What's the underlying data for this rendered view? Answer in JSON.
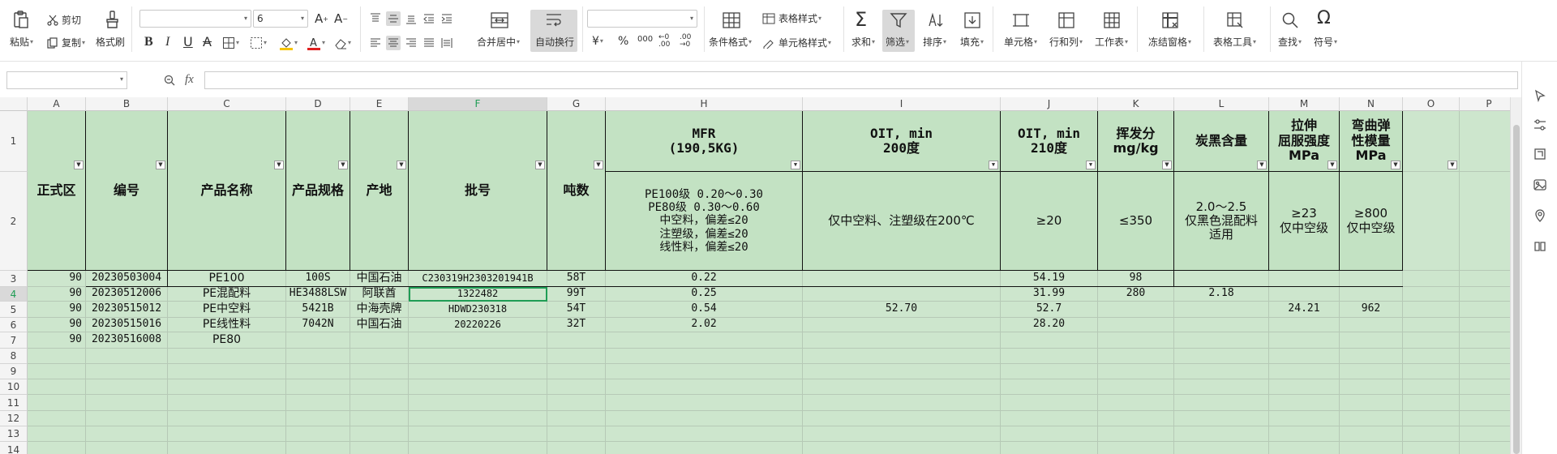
{
  "ribbon": {
    "paste": "粘贴",
    "cut": "剪切",
    "copy": "复制",
    "format_painter": "格式刷",
    "font_name": "",
    "font_size": "6",
    "merge_center": "合并居中",
    "wrap_text": "自动换行",
    "number_format": "",
    "currency": "¥",
    "percent": "%",
    "thousands": "000",
    "inc_decimal": "←0 .00",
    "dec_decimal": ".00 →0",
    "conditional_format": "条件格式",
    "table_style": "表格样式",
    "cell_style": "单元格样式",
    "sum": "求和",
    "filter": "筛选",
    "sort": "排序",
    "fill": "填充",
    "cell": "单元格",
    "row_col": "行和列",
    "worksheet": "工作表",
    "freeze": "冻结窗格",
    "table_tools": "表格工具",
    "find": "查找",
    "symbol": "符号",
    "bold": "B",
    "italic": "I",
    "underline": "U",
    "strike": "A"
  },
  "formula_bar": {
    "name_box": "",
    "fx": "fx",
    "formula": ""
  },
  "columns": [
    "A",
    "B",
    "C",
    "D",
    "E",
    "F",
    "G",
    "H",
    "I",
    "J",
    "K",
    "L",
    "M",
    "N",
    "O",
    "P"
  ],
  "rows": [
    "1",
    "2",
    "3",
    "4",
    "5",
    "6",
    "7",
    "8",
    "9",
    "10",
    "11",
    "12",
    "13",
    "14"
  ],
  "headers": {
    "A": "正式区",
    "B": "编号",
    "C": "产品名称",
    "D": "产品规格",
    "E": "产地",
    "F": "批号",
    "G": "吨数",
    "H1": "MFR\n(190,5KG)",
    "I1": "OIT, min\n200度",
    "J1": "OIT, min\n210度",
    "K1": "挥发分\nmg/kg",
    "L1": "炭黑含量",
    "M1": "拉伸\n屈服强度\nMPa",
    "N1": "弯曲弹\n性模量\nMPa",
    "H2": "PE100级 0.20～0.30\nPE80级 0.30～0.60\n中空料，偏差≤20\n注塑级，偏差≤20\n线性料，偏差≤20",
    "I2": "仅中空料、注塑级在200℃",
    "J2": "≥20",
    "K2": "≤350",
    "L2": "2.0～2.5\n仅黑色混配料\n适用",
    "M2": "≥23\n仅中空级",
    "N2": "≥800\n仅中空级"
  },
  "data_rows": [
    {
      "A": "90",
      "B": "20230503004",
      "C": "PE100",
      "D": "100S",
      "E": "中国石油",
      "F": "C230319H2303201941B",
      "G": "58T",
      "H": "0.22",
      "I": "",
      "J": "54.19",
      "K": "98",
      "L": "",
      "M": "",
      "N": ""
    },
    {
      "A": "90",
      "B": "20230512006",
      "C": "PE混配料",
      "D": "HE3488LSW",
      "E": "阿联酋",
      "F": "1322482",
      "G": "99T",
      "H": "0.25",
      "I": "",
      "J": "31.99",
      "K": "280",
      "L": "2.18",
      "M": "",
      "N": ""
    },
    {
      "A": "90",
      "B": "20230515012",
      "C": "PE中空料",
      "D": "5421B",
      "E": "中海壳牌",
      "F": "HDWD230318",
      "G": "54T",
      "H": "0.54",
      "I": "52.70",
      "J": "52.7",
      "K": "",
      "L": "",
      "M": "24.21",
      "N": "962"
    },
    {
      "A": "90",
      "B": "20230515016",
      "C": "PE线性料",
      "D": "7042N",
      "E": "中国石油",
      "F": "20220226",
      "G": "32T",
      "H": "2.02",
      "I": "",
      "J": "28.20",
      "K": "",
      "L": "",
      "M": "",
      "N": ""
    },
    {
      "A": "90",
      "B": "20230516008",
      "C": "PE80",
      "D": "",
      "E": "",
      "F": "",
      "G": "",
      "H": "",
      "I": "",
      "J": "",
      "K": "",
      "L": "",
      "M": "",
      "N": ""
    }
  ],
  "colors": {
    "sheet_bg": "#cde6cd",
    "header_bg": "#c3e2c3",
    "selection": "#1f9d55"
  }
}
